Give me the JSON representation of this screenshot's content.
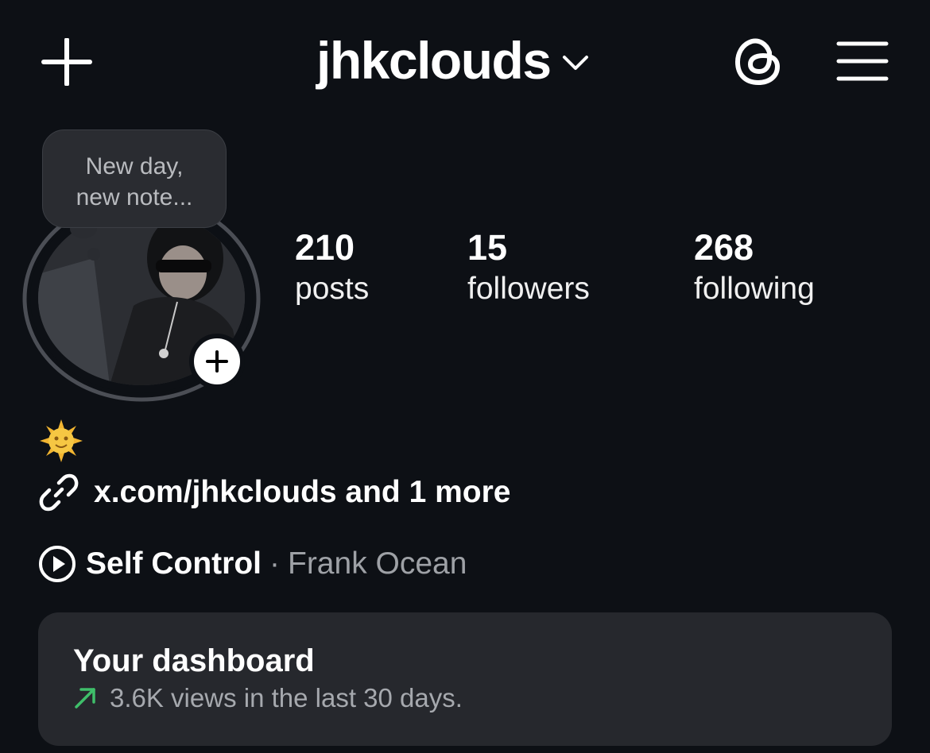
{
  "header": {
    "username": "jhkclouds",
    "icons": {
      "new": "plus-icon",
      "switch": "chevron-down-icon",
      "threads": "threads-icon",
      "menu": "hamburger-menu-icon"
    }
  },
  "note": {
    "text_line1": "New day,",
    "text_line2": "new note..."
  },
  "stats": [
    {
      "value": "210",
      "label": "posts"
    },
    {
      "value": "15",
      "label": "followers"
    },
    {
      "value": "268",
      "label": "following"
    }
  ],
  "bio": {
    "emoji": "🌞",
    "link_text": "x.com/jhkclouds and 1 more"
  },
  "music": {
    "song": "Self Control",
    "separator": "·",
    "artist": "Frank Ocean"
  },
  "dashboard": {
    "title": "Your dashboard",
    "subtitle": "3.6K views in the last 30 days.",
    "trend_color": "#3fbf6a"
  }
}
